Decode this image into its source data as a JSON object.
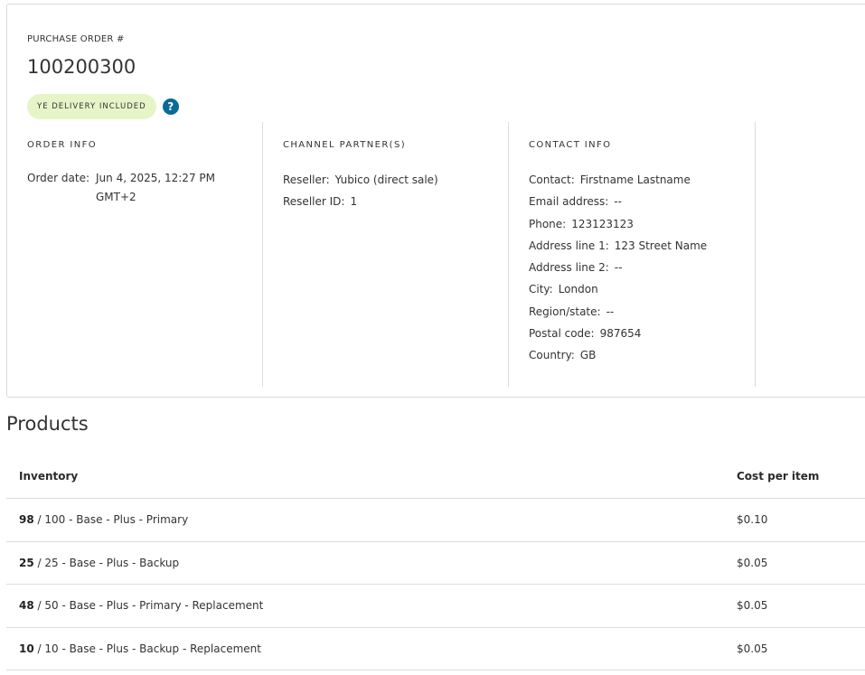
{
  "purchase_order": {
    "label": "PURCHASE ORDER #",
    "number": "100200300",
    "badge": "YE DELIVERY INCLUDED",
    "help_glyph": "?"
  },
  "order_info": {
    "title": "ORDER INFO",
    "order_date_label": "Order date:",
    "order_date_value": "Jun 4, 2025, 12:27 PM GMT+2"
  },
  "channel_partners": {
    "title": "CHANNEL PARTNER(S)",
    "rows": [
      {
        "label": "Reseller:",
        "value": "Yubico (direct sale)"
      },
      {
        "label": "Reseller ID:",
        "value": "1"
      }
    ]
  },
  "contact_info": {
    "title": "CONTACT INFO",
    "rows": [
      {
        "label": "Contact:",
        "value": "Firstname Lastname"
      },
      {
        "label": "Email address:",
        "value": "--"
      },
      {
        "label": "Phone:",
        "value": "123123123"
      },
      {
        "label": "Address line 1:",
        "value": "123 Street Name"
      },
      {
        "label": "Address line 2:",
        "value": "--"
      },
      {
        "label": "City:",
        "value": "London"
      },
      {
        "label": "Region/state:",
        "value": "--"
      },
      {
        "label": "Postal code:",
        "value": "987654"
      },
      {
        "label": "Country:",
        "value": "GB"
      }
    ]
  },
  "products": {
    "title": "Products",
    "columns": [
      "Inventory",
      "Cost per item"
    ],
    "rows": [
      {
        "qty": "98",
        "rest": " / 100 - Base - Plus - Primary",
        "cost": "$0.10"
      },
      {
        "qty": "25",
        "rest": " / 25 - Base - Plus - Backup",
        "cost": "$0.05"
      },
      {
        "qty": "48",
        "rest": " / 50 - Base - Plus - Primary - Replacement",
        "cost": "$0.05"
      },
      {
        "qty": "10",
        "rest": " / 10 - Base - Plus - Backup - Replacement",
        "cost": "$0.05"
      }
    ]
  }
}
